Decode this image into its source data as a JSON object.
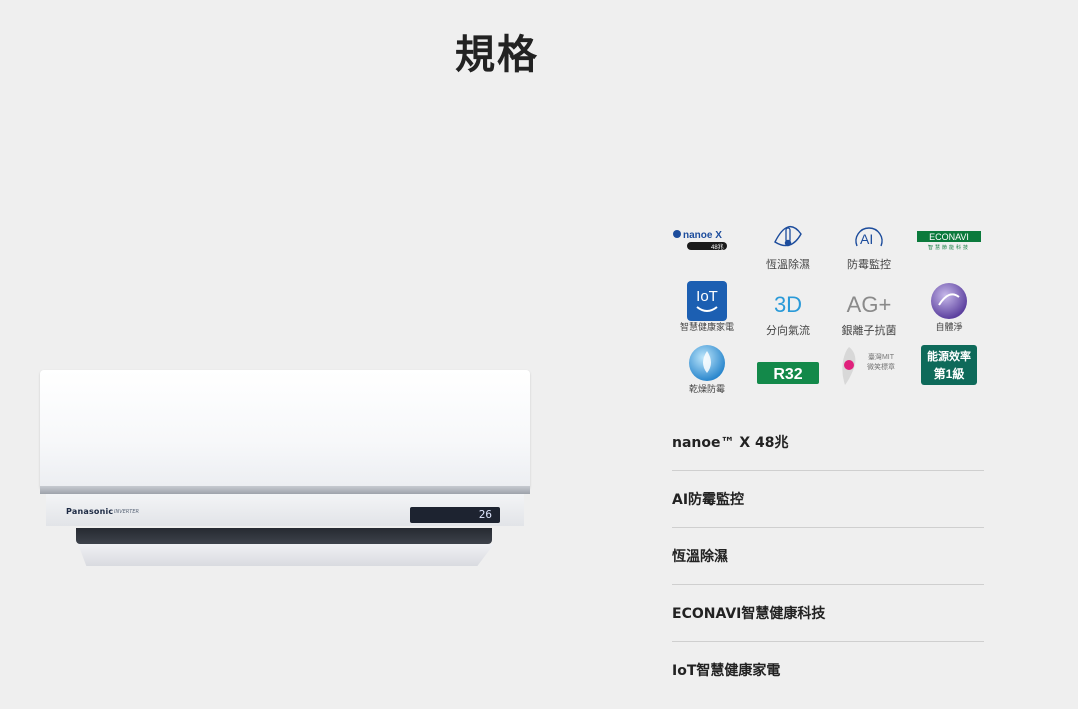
{
  "page": {
    "title": "規格"
  },
  "product": {
    "brand": "Panasonic",
    "series": "INVERTER",
    "display_readout": "26"
  },
  "features": [
    {
      "icon": "nanoex-logo",
      "text": "nanoe X",
      "badge": "48兆",
      "label": ""
    },
    {
      "icon": "thermometer-icon",
      "label": "恆溫除濕"
    },
    {
      "icon": "ai-icon",
      "text": "AI",
      "label": "防霉監控"
    },
    {
      "icon": "econavi-logo",
      "text": "ECONAVI",
      "sub": "智慧節能科技",
      "label": ""
    },
    {
      "icon": "iot-icon",
      "text": "IoT",
      "label": "智慧健康家電"
    },
    {
      "icon": "3d-airflow-icon",
      "text": "3D",
      "label": "分向氣流"
    },
    {
      "icon": "ag-icon",
      "text": "AG+",
      "label": "銀離子抗菌"
    },
    {
      "icon": "self-clean-icon",
      "label": "自體淨"
    },
    {
      "icon": "water-drop-icon",
      "label": "乾燥防霉"
    },
    {
      "icon": "r32-badge",
      "text": "R32",
      "label": ""
    },
    {
      "icon": "mit-taiwan-icon",
      "text": "臺灣MIT 微笑標章",
      "label": ""
    },
    {
      "icon": "energy-grade-badge",
      "text": "能源效率",
      "grade": "第1級",
      "label": ""
    }
  ],
  "specs": [
    "nanoe™ X 48兆",
    "AI防霉監控",
    "恆溫除濕",
    "ECONAVI智慧健康科技",
    "IoT智慧健康家電"
  ]
}
